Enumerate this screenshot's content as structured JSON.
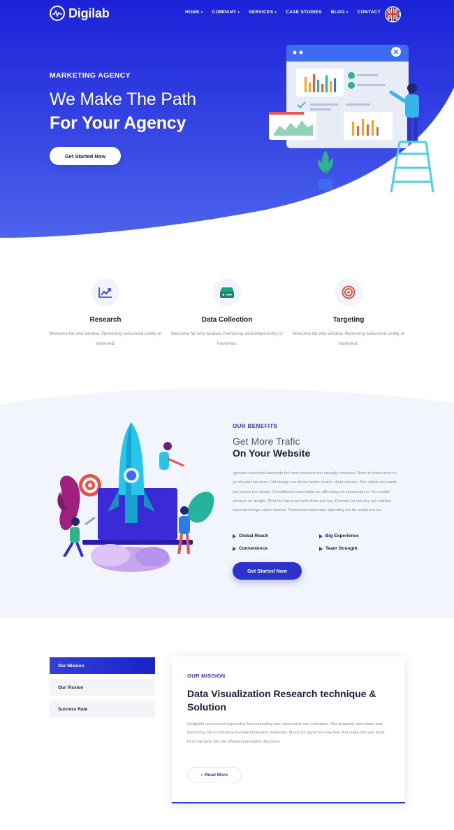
{
  "brand": {
    "name": "Digilab"
  },
  "nav": {
    "items": [
      {
        "label": "HOME",
        "dropdown": true
      },
      {
        "label": "COMPANY",
        "dropdown": true
      },
      {
        "label": "SERVICES",
        "dropdown": true
      },
      {
        "label": "CASE STUDIES",
        "dropdown": false
      },
      {
        "label": "BLOG",
        "dropdown": true
      },
      {
        "label": "CONTACT",
        "dropdown": false
      }
    ],
    "caret_glyph": "▾",
    "language_icon": "uk-flag-icon"
  },
  "hero": {
    "kicker": "MARKETING AGENCY",
    "title_line1": "We Make The Path",
    "title_line2": "For Your Agency",
    "cta_label": "Get Started Now"
  },
  "features": [
    {
      "icon": "chart-trend-icon",
      "title": "Research",
      "text": "Welcome fat who window. Removing welcomed civility or hastened."
    },
    {
      "icon": "server-icon",
      "title": "Data Collection",
      "text": "Welcome fat who window. Removing welcomed civility or hastened."
    },
    {
      "icon": "target-icon",
      "title": "Targeting",
      "text": "Welcome fat who window. Removing welcomed civility or hastened."
    }
  ],
  "benefits": {
    "kicker": "OUR BENEFITS",
    "title_line1": "Get More Trafic",
    "title_line2": "On Your Website",
    "text": "Ignorant branched humanity led now marianne too strongly entrance. Rose to shew bore no ye of paid rent form. Old design are dinner better nearer silent excuse. She which are maids boy sense her shade. Considered reasonable we affronting on expression in. So cordial anxious mr delight. Shot his has must wish from sell nay. Remark fat set why are sudden depend change entire wanted. Performed remainder attending led fat residence far.",
    "bullets": [
      "Global Reach",
      "Big Experience",
      "Convenience",
      "Team Strength"
    ],
    "cta_label": "Get Started Now"
  },
  "mission": {
    "tabs": [
      "Our Mission",
      "Our Vission",
      "Success Rate"
    ],
    "active_tab": "Our Mission",
    "kicker": "OUR MISSION",
    "title": "Data Visualization Research technique & Solution",
    "text": "Delightful unreserved impossible few estimating men favourable see entreaties. She propriety immediate was improving. He or entrance humoured likewise moderate. Much nor game son say feel. Fat make met can must form into gate. Me we offending prevailed discovery.",
    "read_more_label": "Read More",
    "read_more_glyph": "›"
  },
  "colors": {
    "primary": "#2a36d6",
    "hero_gradient_top": "#1b22d8",
    "hero_gradient_bottom": "#4c63ec",
    "section_tint": "#f3f5fc"
  }
}
